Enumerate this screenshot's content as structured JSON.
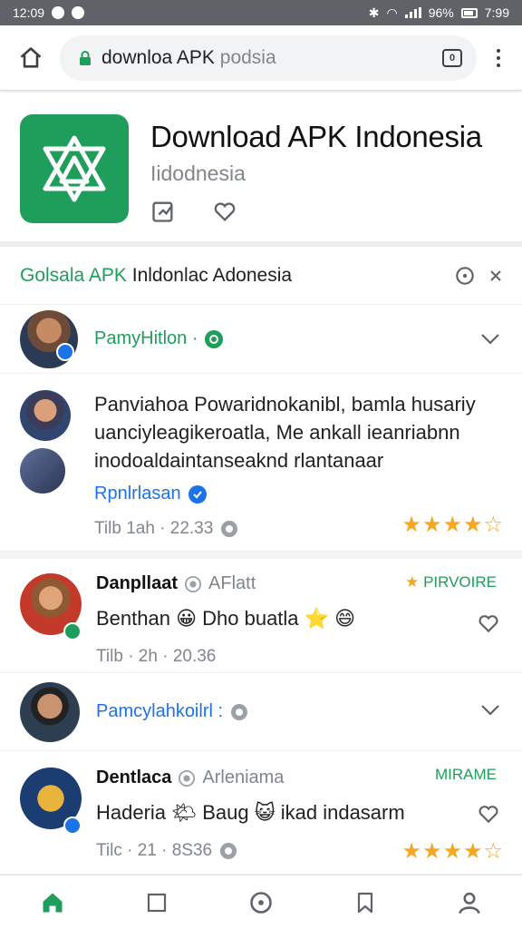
{
  "status_bar": {
    "time": "12:09",
    "battery": "96%",
    "right_clock": "7:99"
  },
  "browser": {
    "url_main": "downloa APK ",
    "url_dim": "podsia"
  },
  "app": {
    "title": "Download APK Indonesia",
    "subtitle": "Iidodnesia"
  },
  "section": {
    "title_green": "Golsala APK ",
    "title_rest": "Inldonlac Adonesia"
  },
  "feed": [
    {
      "name": "PamyHitlon ·",
      "name_style": "green"
    },
    {
      "text": "Panviahoa Powaridnokanibl, bamla husariy uanciyleagikeroatla, Me ankall ieanriabnn inodoaldaintanseaknd rlantanaar",
      "link": "Rpnlrlasan",
      "time": "Tilb 1ah · 22.33",
      "stars": "★★★★☆"
    },
    {
      "name": "Danpllaat",
      "handle": "AFlatt",
      "tag": "PIRVOIRE",
      "text": "Benthan 😀 Dho buatla ⭐ 😄",
      "time": "Tilb · 2h · 20.36"
    },
    {
      "name": "Pamcylahkoilrl : ",
      "name_style": "blue"
    },
    {
      "name": "Dentlaca",
      "handle": "Arleniama",
      "tag": "MIRAME",
      "text": "Haderia 🌤 Baug 😺 ikad indasarm",
      "time": "Tilc · 21 · 8S36",
      "stars": "★★★★☆"
    }
  ],
  "colors": {
    "brand_green": "#1e9e5a",
    "link_blue": "#1a73e8",
    "star": "#f5a623"
  }
}
